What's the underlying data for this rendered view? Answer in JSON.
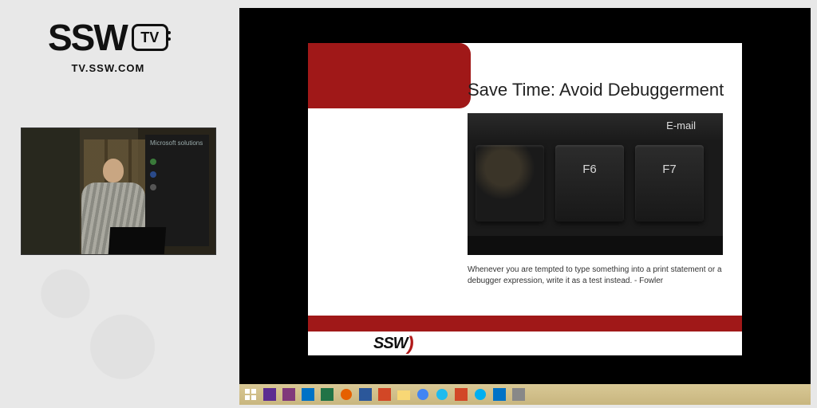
{
  "brand": {
    "name": "SSW",
    "badge": "TV",
    "url": "TV.SSW.COM"
  },
  "speaker": {
    "banner_text": "Microsoft solutions"
  },
  "slide": {
    "title": "Save Time: Avoid Debuggerment",
    "caption": "Whenever you are tempted to type something into a print statement or a debugger expression, write it as a test instead. - Fowler",
    "footer_logo": "SSW",
    "keyboard": {
      "top_label": "E-mail",
      "keys": [
        "",
        "F6",
        "F7"
      ]
    }
  },
  "taskbar": {
    "items": [
      {
        "name": "start",
        "color": "#fff"
      },
      {
        "name": "visual-studio",
        "color": "#5c2d91"
      },
      {
        "name": "onenote",
        "color": "#80397b"
      },
      {
        "name": "outlook",
        "color": "#0072c6"
      },
      {
        "name": "excel",
        "color": "#217346"
      },
      {
        "name": "firefox",
        "color": "#e66000"
      },
      {
        "name": "word",
        "color": "#2b579a"
      },
      {
        "name": "powerpoint",
        "color": "#d24726"
      },
      {
        "name": "explorer",
        "color": "#f8d775"
      },
      {
        "name": "chrome",
        "color": "#4285f4"
      },
      {
        "name": "ie",
        "color": "#1ebbee"
      },
      {
        "name": "app1",
        "color": "#d24726"
      },
      {
        "name": "skype",
        "color": "#00aff0"
      },
      {
        "name": "app2",
        "color": "#0072c6"
      },
      {
        "name": "app3",
        "color": "#888"
      }
    ]
  },
  "colors": {
    "accent": "#a01818"
  }
}
